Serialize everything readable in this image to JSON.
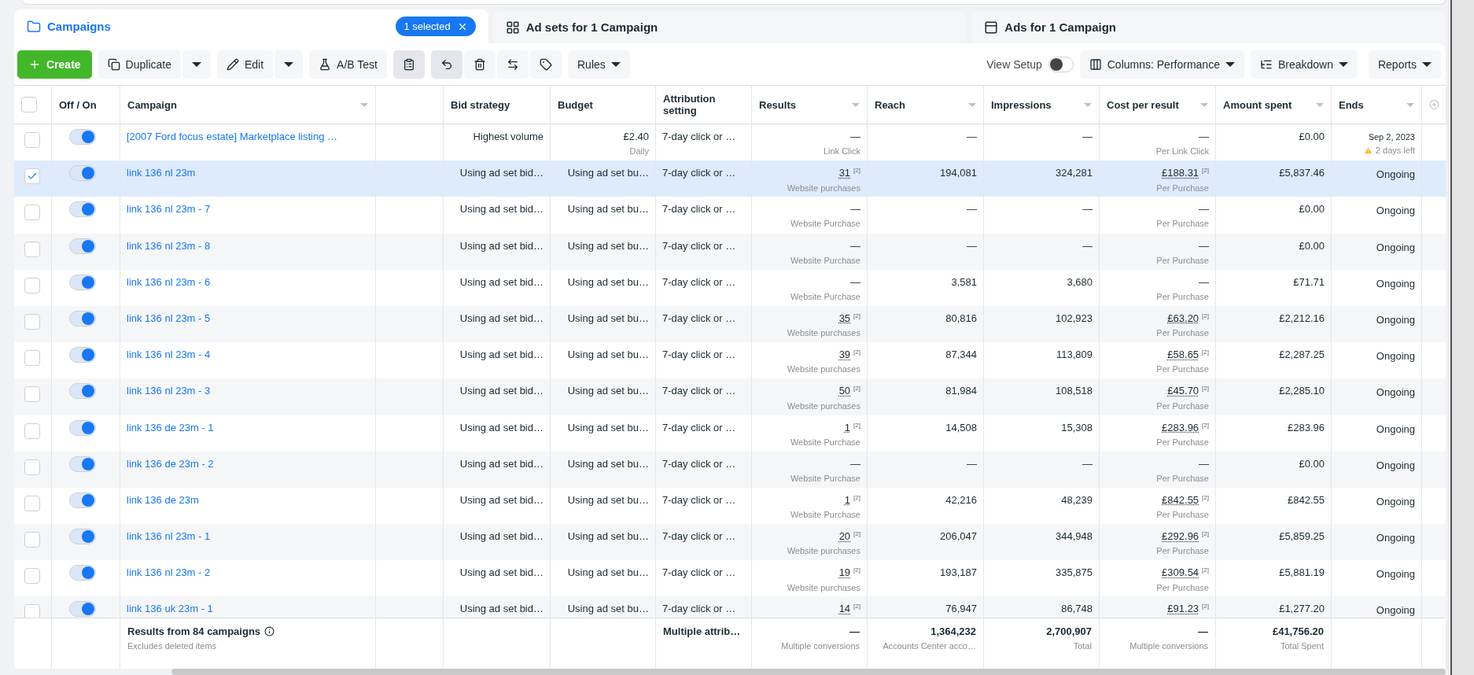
{
  "tabs": [
    {
      "label": "Campaigns",
      "kind": "campaigns",
      "selected": true,
      "badge": "1 selected"
    },
    {
      "label": "Ad sets for 1 Campaign",
      "kind": "adsets",
      "selected": false
    },
    {
      "label": "Ads for 1 Campaign",
      "kind": "ads",
      "selected": false
    }
  ],
  "toolbar": {
    "create": "Create",
    "duplicate": "Duplicate",
    "edit": "Edit",
    "ab_test": "A/B Test",
    "rules": "Rules",
    "view_setup": {
      "label": "View Setup",
      "on": false
    },
    "columns": "Columns: Performance",
    "breakdown": "Breakdown",
    "reports": "Reports"
  },
  "table": {
    "header_checkbox": {
      "checked": false
    },
    "columns": [
      {
        "label": "Off / On",
        "sort_caret": false
      },
      {
        "label": "Campaign",
        "sort_caret": true
      },
      {
        "sort_caret": false
      },
      {
        "label": "Bid strategy",
        "sort_caret": false
      },
      {
        "label": "Budget",
        "sort_caret": false
      },
      {
        "label": "Attribution setting",
        "sort_caret": false
      },
      {
        "label": "Results",
        "sort_caret": true
      },
      {
        "label": "Reach",
        "sort_caret": true
      },
      {
        "label": "Impressions",
        "sort_caret": true
      },
      {
        "label": "Cost per result",
        "sort_caret": true
      },
      {
        "label": "Amount spent",
        "sort_caret": true
      },
      {
        "label": "Ends",
        "sort_caret": true
      }
    ],
    "rows": [
      {
        "selected": false,
        "checked": false,
        "on": true,
        "name": "[2007 Ford focus estate] Marketplace listing …",
        "bid": "Highest volume",
        "budget": {
          "value": "£2.40",
          "sub": "Daily"
        },
        "attribution": "7-day click or …",
        "results": {
          "value": "—",
          "sub": "Link Click"
        },
        "reach": "—",
        "impressions": "—",
        "cost": {
          "value": "—",
          "sub": "Per Link Click"
        },
        "spent": "£0.00",
        "ends": {
          "value": "Sep 2, 2023",
          "warning": "2 days left"
        }
      },
      {
        "selected": true,
        "checked": true,
        "on": true,
        "name": "link 136 nl 23m",
        "bid": "Using ad set bid…",
        "budget": {
          "value": "Using ad set bu…"
        },
        "attribution": "7-day click or …",
        "results": {
          "value": "31",
          "note": "[2]",
          "sub": "Website purchases"
        },
        "reach": "194,081",
        "impressions": "324,281",
        "cost": {
          "value": "£188.31",
          "note": "[2]",
          "sub": "Per Purchase"
        },
        "spent": "£5,837.46",
        "ends": {
          "value": "Ongoing"
        }
      },
      {
        "selected": false,
        "checked": false,
        "on": true,
        "name": "link 136 nl 23m - 7",
        "bid": "Using ad set bid…",
        "budget": {
          "value": "Using ad set bu…"
        },
        "attribution": "7-day click or …",
        "results": {
          "value": "—",
          "sub": "Website Purchase"
        },
        "reach": "—",
        "impressions": "—",
        "cost": {
          "value": "—",
          "sub": "Per Purchase"
        },
        "spent": "£0.00",
        "ends": {
          "value": "Ongoing"
        }
      },
      {
        "selected": false,
        "checked": false,
        "on": true,
        "name": "link 136 nl 23m - 8",
        "bid": "Using ad set bid…",
        "budget": {
          "value": "Using ad set bu…"
        },
        "attribution": "7-day click or …",
        "results": {
          "value": "—",
          "sub": "Website Purchase"
        },
        "reach": "—",
        "impressions": "—",
        "cost": {
          "value": "—",
          "sub": "Per Purchase"
        },
        "spent": "£0.00",
        "ends": {
          "value": "Ongoing"
        }
      },
      {
        "selected": false,
        "checked": false,
        "on": true,
        "name": "link 136 nl 23m - 6",
        "bid": "Using ad set bid…",
        "budget": {
          "value": "Using ad set bu…"
        },
        "attribution": "7-day click or …",
        "results": {
          "value": "—",
          "sub": "Website Purchase"
        },
        "reach": "3,581",
        "impressions": "3,680",
        "cost": {
          "value": "—",
          "sub": "Per Purchase"
        },
        "spent": "£71.71",
        "ends": {
          "value": "Ongoing"
        }
      },
      {
        "selected": false,
        "checked": false,
        "on": true,
        "name": "link 136 nl 23m - 5",
        "bid": "Using ad set bid…",
        "budget": {
          "value": "Using ad set bu…"
        },
        "attribution": "7-day click or …",
        "results": {
          "value": "35",
          "note": "[2]",
          "sub": "Website purchases"
        },
        "reach": "80,816",
        "impressions": "102,923",
        "cost": {
          "value": "£63.20",
          "note": "[2]",
          "sub": "Per Purchase"
        },
        "spent": "£2,212.16",
        "ends": {
          "value": "Ongoing"
        }
      },
      {
        "selected": false,
        "checked": false,
        "on": true,
        "name": "link 136 nl 23m - 4",
        "bid": "Using ad set bid…",
        "budget": {
          "value": "Using ad set bu…"
        },
        "attribution": "7-day click or …",
        "results": {
          "value": "39",
          "note": "[2]",
          "sub": "Website purchases"
        },
        "reach": "87,344",
        "impressions": "113,809",
        "cost": {
          "value": "£58.65",
          "note": "[2]",
          "sub": "Per Purchase"
        },
        "spent": "£2,287.25",
        "ends": {
          "value": "Ongoing"
        }
      },
      {
        "selected": false,
        "checked": false,
        "on": true,
        "name": "link 136 nl 23m - 3",
        "bid": "Using ad set bid…",
        "budget": {
          "value": "Using ad set bu…"
        },
        "attribution": "7-day click or …",
        "results": {
          "value": "50",
          "note": "[2]",
          "sub": "Website purchases"
        },
        "reach": "81,984",
        "impressions": "108,518",
        "cost": {
          "value": "£45.70",
          "note": "[2]",
          "sub": "Per Purchase"
        },
        "spent": "£2,285.10",
        "ends": {
          "value": "Ongoing"
        }
      },
      {
        "selected": false,
        "checked": false,
        "on": true,
        "name": "link 136 de 23m - 1",
        "bid": "Using ad set bid…",
        "budget": {
          "value": "Using ad set bu…"
        },
        "attribution": "7-day click or …",
        "results": {
          "value": "1",
          "note": "[2]",
          "sub": "Website Purchase"
        },
        "reach": "14,508",
        "impressions": "15,308",
        "cost": {
          "value": "£283.96",
          "note": "[2]",
          "sub": "Per Purchase"
        },
        "spent": "£283.96",
        "ends": {
          "value": "Ongoing"
        }
      },
      {
        "selected": false,
        "checked": false,
        "on": true,
        "name": "link 136 de 23m - 2",
        "bid": "Using ad set bid…",
        "budget": {
          "value": "Using ad set bu…"
        },
        "attribution": "7-day click or …",
        "results": {
          "value": "—",
          "sub": "Website Purchase"
        },
        "reach": "—",
        "impressions": "—",
        "cost": {
          "value": "—",
          "sub": "Per Purchase"
        },
        "spent": "£0.00",
        "ends": {
          "value": "Ongoing"
        }
      },
      {
        "selected": false,
        "checked": false,
        "on": true,
        "name": "link 136 de 23m",
        "bid": "Using ad set bid…",
        "budget": {
          "value": "Using ad set bu…"
        },
        "attribution": "7-day click or …",
        "results": {
          "value": "1",
          "note": "[2]",
          "sub": "Website Purchase"
        },
        "reach": "42,216",
        "impressions": "48,239",
        "cost": {
          "value": "£842.55",
          "note": "[2]",
          "sub": "Per Purchase"
        },
        "spent": "£842.55",
        "ends": {
          "value": "Ongoing"
        }
      },
      {
        "selected": false,
        "checked": false,
        "on": true,
        "name": "link 136 nl 23m - 1",
        "bid": "Using ad set bid…",
        "budget": {
          "value": "Using ad set bu…"
        },
        "attribution": "7-day click or …",
        "results": {
          "value": "20",
          "note": "[2]",
          "sub": "Website purchases"
        },
        "reach": "206,047",
        "impressions": "344,948",
        "cost": {
          "value": "£292.96",
          "note": "[2]",
          "sub": "Per Purchase"
        },
        "spent": "£5,859.25",
        "ends": {
          "value": "Ongoing"
        }
      },
      {
        "selected": false,
        "checked": false,
        "on": true,
        "name": "link 136 nl 23m - 2",
        "bid": "Using ad set bid…",
        "budget": {
          "value": "Using ad set bu…"
        },
        "attribution": "7-day click or …",
        "results": {
          "value": "19",
          "note": "[2]",
          "sub": "Website purchases"
        },
        "reach": "193,187",
        "impressions": "335,875",
        "cost": {
          "value": "£309.54",
          "note": "[2]",
          "sub": "Per Purchase"
        },
        "spent": "£5,881.19",
        "ends": {
          "value": "Ongoing"
        }
      },
      {
        "selected": false,
        "checked": false,
        "on": true,
        "name": "link 136 uk 23m - 1",
        "bid": "Using ad set bid…",
        "budget": {
          "value": "Using ad set bu…"
        },
        "attribution": "7-day click or …",
        "results": {
          "value": "14",
          "note": "[2]"
        },
        "reach": "76,947",
        "impressions": "86,748",
        "cost": {
          "value": "£91.23",
          "note": "[2]"
        },
        "spent": "£1,277.20",
        "ends": {
          "value": "Ongoing"
        }
      }
    ],
    "summary": {
      "title": "Results from 84 campaigns",
      "sub": "Excludes deleted items",
      "attribution": "Multiple attrib…",
      "results": {
        "value": "—",
        "sub": "Multiple conversions"
      },
      "reach": {
        "value": "1,364,232",
        "sub": "Accounts Center acco…"
      },
      "impressions": {
        "value": "2,700,907",
        "sub": "Total"
      },
      "cost": {
        "value": "—",
        "sub": "Multiple conversions"
      },
      "spent": {
        "value": "£41,756.20",
        "sub": "Total Spent"
      }
    }
  }
}
